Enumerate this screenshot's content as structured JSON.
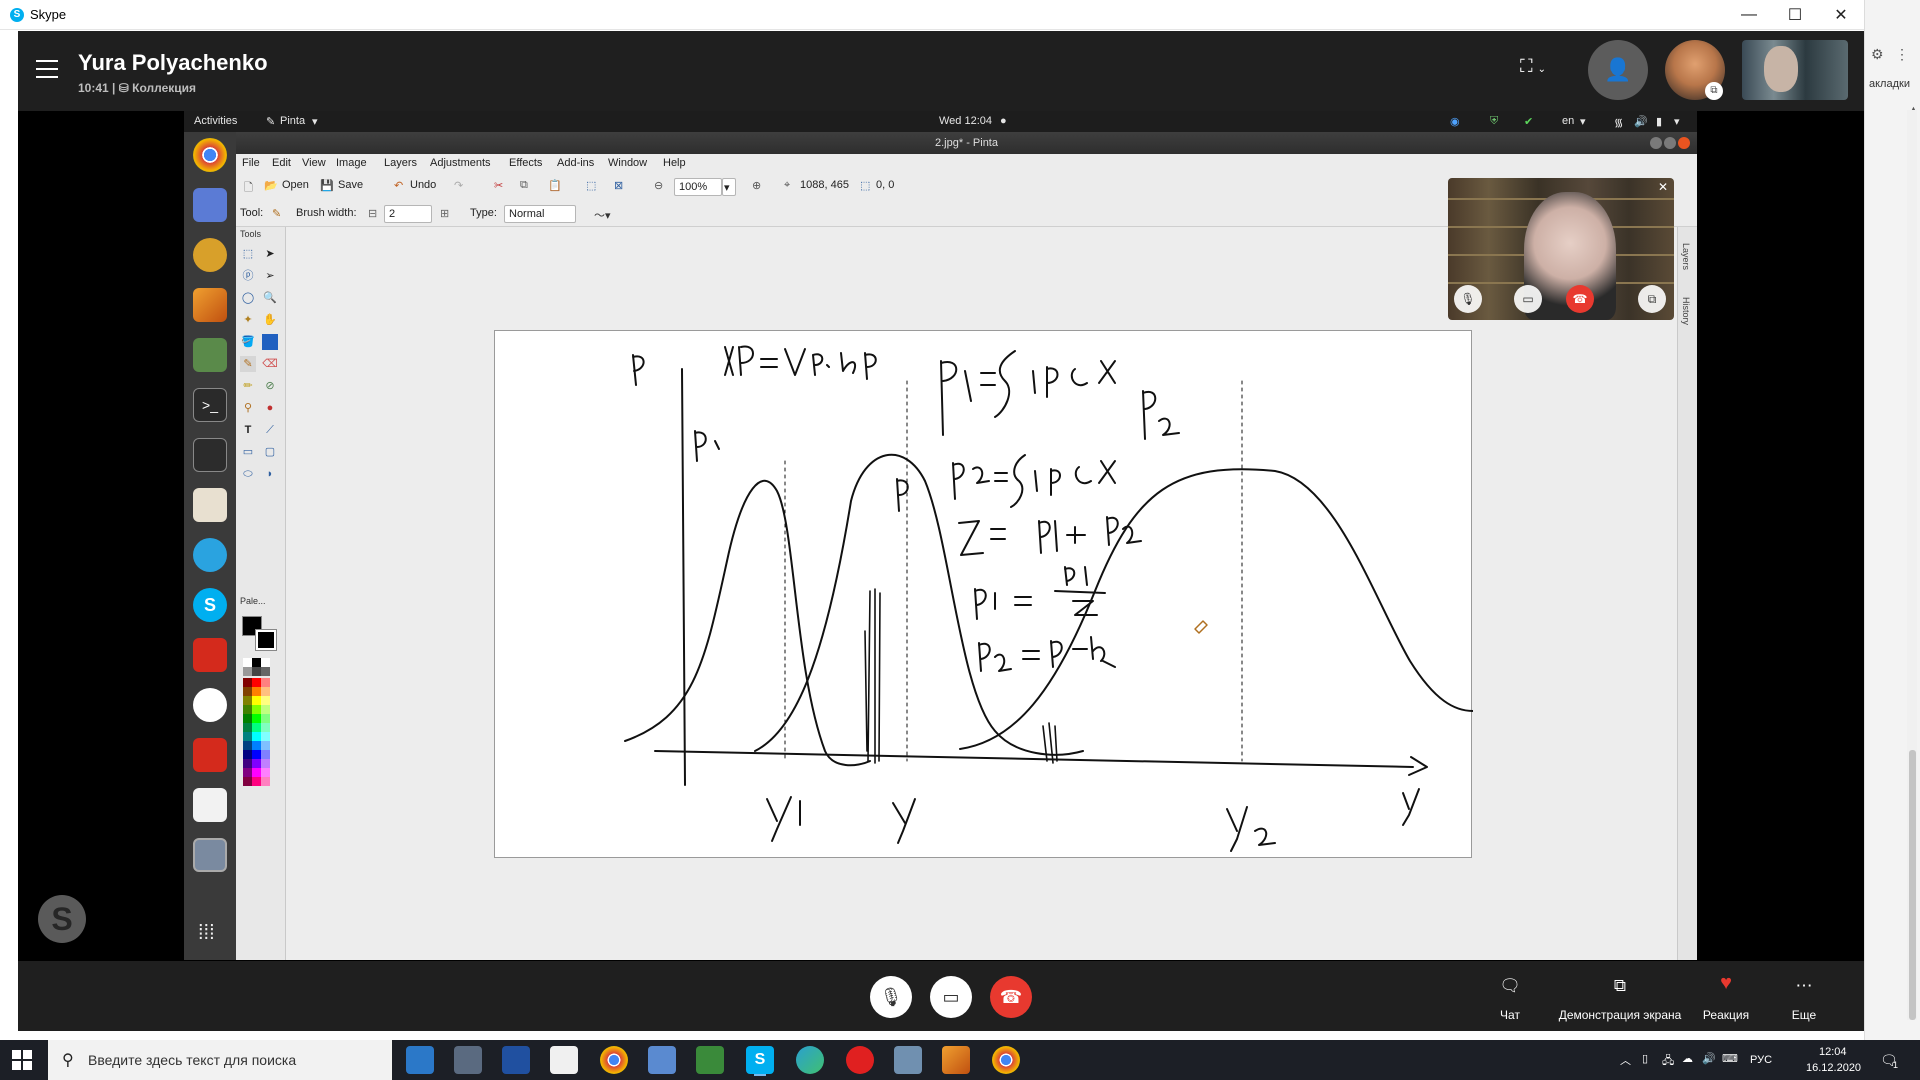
{
  "window": {
    "app_title": "Skype",
    "controls": {
      "minimize": "—",
      "maximize": "☐",
      "close": "✕"
    }
  },
  "background_browser": {
    "partial_text": "акладки"
  },
  "call": {
    "caller_name": "Yura Polyachenko",
    "duration": "10:41",
    "collection": "Коллекция",
    "bottom_actions": [
      {
        "label": "Чат",
        "icon": "chat-icon"
      },
      {
        "label": "Демонстрация экрана",
        "icon": "screen-share-icon"
      },
      {
        "label": "Реакция",
        "icon": "heart-icon"
      },
      {
        "label": "Еще",
        "icon": "more-icon"
      }
    ]
  },
  "ubuntu": {
    "activities": "Activities",
    "app_menu": "Pinta",
    "clock": "Wed 12:04",
    "lang": "en"
  },
  "pinta": {
    "title": "2.jpg* - Pinta",
    "menu": [
      "File",
      "Edit",
      "View",
      "Image",
      "Layers",
      "Adjustments",
      "Effects",
      "Add-ins",
      "Window",
      "Help"
    ],
    "toolbar": {
      "open": "Open",
      "save": "Save",
      "undo": "Undo",
      "zoom": "100%",
      "cursor_pos": "1088, 465",
      "selection_size": "0, 0"
    },
    "toolbar2": {
      "tool_label": "Tool:",
      "brush_width_label": "Brush width:",
      "brush_width": "2",
      "type_label": "Type:",
      "type": "Normal"
    },
    "panels": {
      "tools": "Tools",
      "palette": "Pale...",
      "layers": "Layers",
      "history": "History"
    }
  },
  "taskbar": {
    "search_placeholder": "Введите здесь текст для поиска",
    "lang": "РУС",
    "time": "12:04",
    "date": "16.12.2020",
    "notifications": "1"
  },
  "colors": {
    "skype_blue": "#00aff0",
    "hangup_red": "#e8392f",
    "call_bg": "#1f1f1f",
    "ubuntu_orange": "#e95420",
    "taskbar": "#1c1f26"
  }
}
